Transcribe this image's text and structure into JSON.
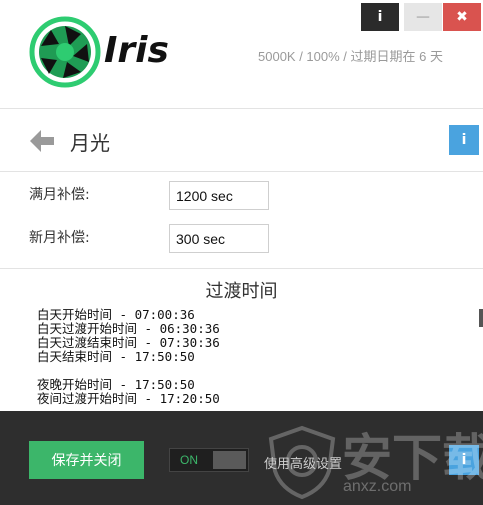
{
  "window": {
    "info_label": "i",
    "min_label": "—",
    "close_label": "✖"
  },
  "header": {
    "logo_text": "Iris",
    "status": "5000K / 100% / 过期日期在 6 天",
    "logo_color": "#2ecc71"
  },
  "titlebar": {
    "title": "月光",
    "info_label": "i"
  },
  "settings": {
    "full_moon_label": "满月补偿:",
    "full_moon_value": "1200 sec",
    "new_moon_label": "新月补偿:",
    "new_moon_value": "300 sec"
  },
  "transition": {
    "title": "过渡时间",
    "day_lines": [
      "白天开始时间 - 07:00:36",
      "白天过渡开始时间 - 06:30:36",
      "白天过渡结束时间 - 07:30:36",
      "白天结束时间 - 17:50:50"
    ],
    "night_lines": [
      "夜晚开始时间 - 17:50:50",
      "夜间过渡开始时间 - 17:20:50"
    ]
  },
  "footer": {
    "save_label": "保存并关闭",
    "toggle_label": "ON",
    "advanced_label": "使用高级设置",
    "info_label": "i"
  },
  "watermark": {
    "text": "安下载",
    "url": "anxz.com"
  },
  "colors": {
    "accent_green": "#3cb66a",
    "info_blue": "#4aa3df",
    "close_red": "#d9534f",
    "footer_bg": "#2e2e2e"
  }
}
